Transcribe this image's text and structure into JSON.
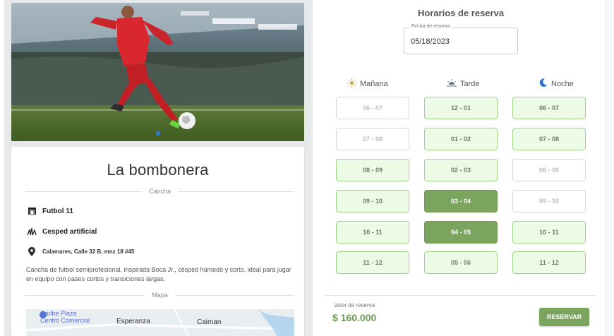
{
  "gallery": {
    "image": "soccer-player-stadium-photo",
    "slides": 2,
    "active_slide": 1
  },
  "venue": {
    "name": "La bombonera",
    "section_label": "Cancha",
    "features": [
      {
        "icon": "goal-icon",
        "text": "Futbol 11"
      },
      {
        "icon": "grass-icon",
        "text": "Cesped artificial"
      },
      {
        "icon": "location-pin-icon",
        "text": "Calamares, Calle 32 B, mnz 18 #45"
      }
    ],
    "description": "Cancha de futbol semiprofesional, inspirada Boca Jr., césped húmedo y corto, ideal para jugar en equipo con pases cortos y transiciones largas.",
    "map_label": "Mapa",
    "map_places": [
      "Caribe Plaza",
      "Centro Comercial",
      "Esperanza",
      "Caiman"
    ]
  },
  "booking": {
    "title": "Horarios de reserva",
    "date_label": "Fecha de reserva",
    "date_value": "05/18/2023",
    "columns": [
      {
        "label": "Mañana",
        "icon": "sun-icon",
        "slots": [
          {
            "time": "06 - 07",
            "state": "busy"
          },
          {
            "time": "07 - 08",
            "state": "busy"
          },
          {
            "time": "08 - 09",
            "state": "free"
          },
          {
            "time": "09 - 10",
            "state": "free"
          },
          {
            "time": "10 - 11",
            "state": "free"
          },
          {
            "time": "11 - 12",
            "state": "free"
          }
        ]
      },
      {
        "label": "Tarde",
        "icon": "sunset-icon",
        "slots": [
          {
            "time": "12 - 01",
            "state": "free"
          },
          {
            "time": "01 - 02",
            "state": "free"
          },
          {
            "time": "02 - 03",
            "state": "free"
          },
          {
            "time": "03 - 04",
            "state": "sel"
          },
          {
            "time": "04 - 05",
            "state": "sel"
          },
          {
            "time": "05 - 06",
            "state": "free"
          }
        ]
      },
      {
        "label": "Noche",
        "icon": "moon-icon",
        "slots": [
          {
            "time": "06 - 07",
            "state": "free"
          },
          {
            "time": "07 - 08",
            "state": "free"
          },
          {
            "time": "08 - 09",
            "state": "busy"
          },
          {
            "time": "09 - 10",
            "state": "busy"
          },
          {
            "time": "10 - 11",
            "state": "free"
          },
          {
            "time": "11 - 12",
            "state": "free"
          }
        ]
      }
    ],
    "price_label": "Valor de reserva",
    "price": "$ 160.000",
    "reserve_button": "RESERVAR"
  },
  "colors": {
    "accent": "#7ba55f",
    "slot_free_bg": "#ecfbe6",
    "slot_free_border": "#9fd385"
  }
}
